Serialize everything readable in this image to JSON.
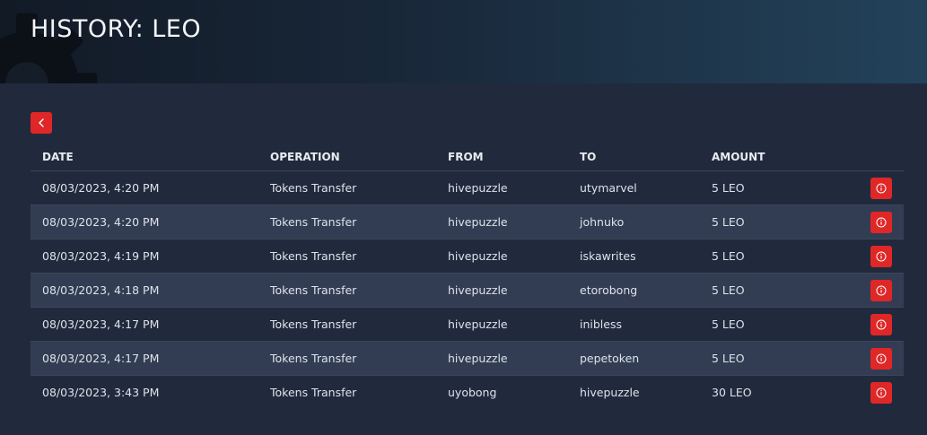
{
  "header": {
    "title": "HISTORY: LEO"
  },
  "table": {
    "columns": {
      "date": "DATE",
      "operation": "OPERATION",
      "from": "FROM",
      "to": "TO",
      "amount": "AMOUNT"
    },
    "rows": [
      {
        "date": "08/03/2023, 4:20 PM",
        "operation": "Tokens Transfer",
        "from": "hivepuzzle",
        "to": "utymarvel",
        "amount": "5 LEO"
      },
      {
        "date": "08/03/2023, 4:20 PM",
        "operation": "Tokens Transfer",
        "from": "hivepuzzle",
        "to": "johnuko",
        "amount": "5 LEO"
      },
      {
        "date": "08/03/2023, 4:19 PM",
        "operation": "Tokens Transfer",
        "from": "hivepuzzle",
        "to": "iskawrites",
        "amount": "5 LEO"
      },
      {
        "date": "08/03/2023, 4:18 PM",
        "operation": "Tokens Transfer",
        "from": "hivepuzzle",
        "to": "etorobong",
        "amount": "5 LEO"
      },
      {
        "date": "08/03/2023, 4:17 PM",
        "operation": "Tokens Transfer",
        "from": "hivepuzzle",
        "to": "inibless",
        "amount": "5 LEO"
      },
      {
        "date": "08/03/2023, 4:17 PM",
        "operation": "Tokens Transfer",
        "from": "hivepuzzle",
        "to": "pepetoken",
        "amount": "5 LEO"
      },
      {
        "date": "08/03/2023, 3:43 PM",
        "operation": "Tokens Transfer",
        "from": "uyobong",
        "to": "hivepuzzle",
        "amount": "30 LEO"
      }
    ]
  },
  "icons": {
    "back": "chevron-left-icon",
    "row_action": "info-icon",
    "header_decoration": "gear-icon"
  },
  "colors": {
    "accent": "#e02727",
    "background": "#212a3d",
    "row_alt": "#323d53"
  }
}
